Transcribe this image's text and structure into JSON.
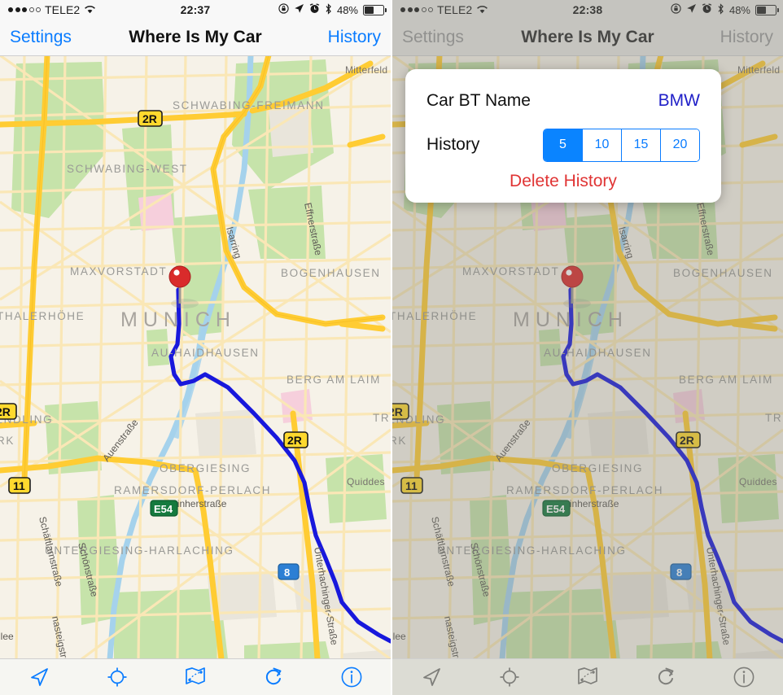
{
  "app": {
    "title": "Where Is My Car",
    "nav_left": "Settings",
    "nav_right": "History"
  },
  "status_left": {
    "carrier": "TELE2",
    "signal_filled": 3,
    "signal_hollow": 2,
    "wifi_icon": "wifi-icon"
  },
  "status_right": {
    "rotation_lock_icon": "rotation-lock-icon",
    "location_icon": "location-arrow-icon",
    "alarm_icon": "alarm-clock-icon",
    "bluetooth_icon": "bluetooth-icon",
    "battery_percent": "48%",
    "battery_level": 48
  },
  "panels": [
    {
      "id": "left",
      "time": "22:37",
      "dimmed": false,
      "popup_visible": false
    },
    {
      "id": "right",
      "time": "22:38",
      "dimmed": true,
      "popup_visible": true
    }
  ],
  "popup": {
    "car_bt_name_label": "Car BT Name",
    "car_bt_name_value": "BMW",
    "history_label": "History",
    "history_options": [
      "5",
      "10",
      "15",
      "20"
    ],
    "history_selected": "5",
    "delete_label": "Delete History"
  },
  "toolbar": {
    "items": [
      {
        "name": "navigate-arrow-icon",
        "label": "Navigate"
      },
      {
        "name": "crosshair-target-icon",
        "label": "Center"
      },
      {
        "name": "map-route-icon",
        "label": "Map"
      },
      {
        "name": "refresh-icon",
        "label": "Refresh"
      },
      {
        "name": "info-icon",
        "label": "Info"
      }
    ]
  },
  "map": {
    "city_label": "MUNICH",
    "pin": {
      "name": "car-location-pin",
      "color": "#D92B2B"
    },
    "route_color": "#1818DC",
    "districts": [
      "SCHWABING-FREIMANN",
      "SCHWABING-WEST",
      "MAXVORSTADT",
      "BOGENHAUSEN",
      "AU-HAIDHAUSEN",
      "BERG AM LAIM",
      "OBERGIESING",
      "RAMERSDORF-PERLACH",
      "UNTERGIESING-HARLACHING",
      "SENDLING",
      "THALERHÖHE",
      "PARK",
      "TR",
      "Mitterfeld",
      "Quiddes"
    ],
    "streets": [
      "Isarring",
      "Effnerstraße",
      "Auenstraße",
      "Werinherstraße",
      "Schäftlarnstraße",
      "Schönstraße",
      "Unterhachinger-Straße",
      "nasteigstraße",
      "llee"
    ],
    "shields": [
      {
        "text": "2R",
        "style": "yellow"
      },
      {
        "text": "2R",
        "style": "yellow"
      },
      {
        "text": "2R",
        "style": "yellow"
      },
      {
        "text": "11",
        "style": "yellow"
      },
      {
        "text": "E54",
        "style": "green"
      },
      {
        "text": "8",
        "style": "blue"
      }
    ],
    "colors": {
      "land": "#F6F2E8",
      "park": "#C4E2A8",
      "water": "#A8D4EE",
      "road_major": "#FFCC33",
      "road_minor": "#FBE9B8",
      "building": "#E8E4DA"
    }
  }
}
